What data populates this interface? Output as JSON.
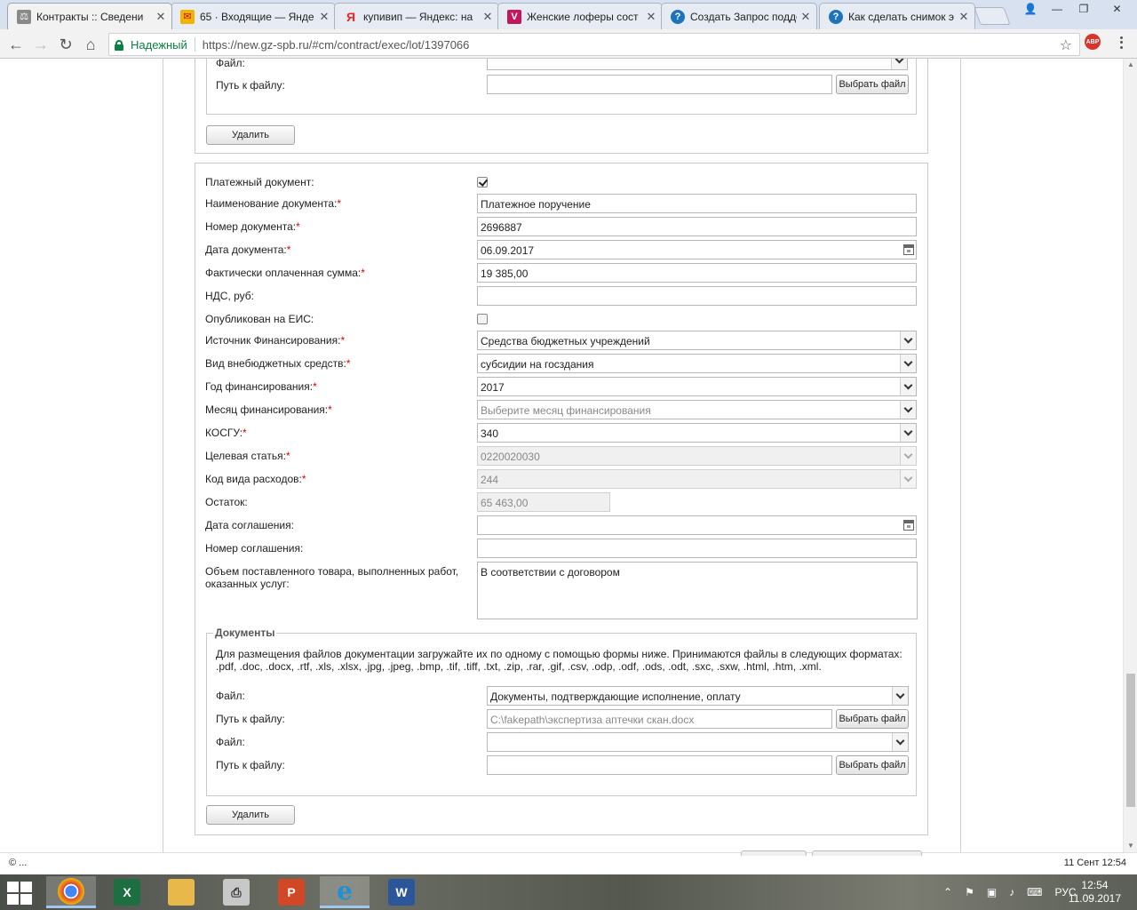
{
  "browser": {
    "tabs": [
      {
        "title": "Контракты :: Сведени",
        "icon": "gavel-icon",
        "color": "#7a7a7a",
        "glyph": "⚖"
      },
      {
        "title": "65 · Входящие — Янде",
        "icon": "mail-icon",
        "color": "#f0b400",
        "glyph": "✉"
      },
      {
        "title": "купивип — Яндекс: на",
        "icon": "yandex-icon",
        "color": "#ffffff",
        "glyph": "Я"
      },
      {
        "title": "Женские лоферы сост",
        "icon": "vip-icon",
        "color": "#c2185b",
        "glyph": "V"
      },
      {
        "title": "Создать Запрос подде",
        "icon": "help-icon",
        "color": "#1e73be",
        "glyph": "?"
      },
      {
        "title": "Как сделать снимок э",
        "icon": "help-icon",
        "color": "#1e73be",
        "glyph": "?"
      }
    ],
    "secure_label": "Надежный",
    "url": "https://new.gz-spb.ru/#cm/contract/exec/lot/1397066",
    "abp_label": "ABP",
    "win_user_icon": "user-icon"
  },
  "top_fragment": {
    "file_label": "Файл:",
    "path_label": "Путь к файлу:",
    "choose_button": "Выбрать файл",
    "delete_button": "Удалить"
  },
  "form": {
    "fields": {
      "payment_doc": {
        "label": "Платежный документ:",
        "checked": true
      },
      "doc_name": {
        "label": "Наименование документа:",
        "required": "*",
        "value": "Платежное поручение"
      },
      "doc_number": {
        "label": "Номер документа:",
        "required": "*",
        "value": "2696887"
      },
      "doc_date": {
        "label": "Дата документа:",
        "required": "*",
        "value": "06.09.2017"
      },
      "paid_sum": {
        "label": "Фактически оплаченная сумма:",
        "required": "*",
        "value": "19 385,00"
      },
      "vat": {
        "label": "НДС, руб:",
        "value": ""
      },
      "published": {
        "label": "Опубликован на ЕИС:",
        "checked": false
      },
      "funding_source": {
        "label": "Источник Финансирования:",
        "required": "*",
        "value": "Средства бюджетных учреждений"
      },
      "extrabudget": {
        "label": "Вид внебюджетных средств:",
        "required": "*",
        "value": "субсидии на госздания"
      },
      "funding_year": {
        "label": "Год финансирования:",
        "required": "*",
        "value": "2017"
      },
      "funding_month": {
        "label": "Месяц финансирования:",
        "required": "*",
        "value": "Выберите месяц финансирования"
      },
      "kosgu": {
        "label": "КОСГУ:",
        "required": "*",
        "value": "340"
      },
      "target_article": {
        "label": "Целевая статья:",
        "required": "*",
        "value": "0220020030"
      },
      "expense_code": {
        "label": "Код вида расходов:",
        "required": "*",
        "value": "244"
      },
      "remainder": {
        "label": "Остаток:",
        "value": "65 463,00"
      },
      "agreement_date": {
        "label": "Дата соглашения:",
        "value": ""
      },
      "agreement_number": {
        "label": "Номер соглашения:",
        "value": ""
      },
      "volume": {
        "label_line1": "Объем поставленного товара, выполненных работ,",
        "label_line2": "оказанных услуг:",
        "value": "В соответствии с договором"
      }
    },
    "documents": {
      "legend": "Документы",
      "info_line1": "Для размещения файлов документации загружайте их по одному с помощью формы ниже. Принимаются файлы в следующих форматах:",
      "info_line2": ".pdf, .doc, .docx, .rtf, .xls, .xlsx, .jpg, .jpeg, .bmp, .tif, .tiff, .txt, .zip, .rar, .gif, .csv, .odp, .odf, .ods, .odt, .sxc, .sxw, .html, .htm, .xml.",
      "file_label": "Файл:",
      "path_label": "Путь к файлу:",
      "file1_value": "Документы, подтверждающие исполнение, оплату",
      "path1_value": "C:\\fakepath\\экспертиза аптечки скан.docx",
      "file2_value": "",
      "path2_value": "",
      "choose_button": "Выбрать файл",
      "delete_button": "Удалить"
    }
  },
  "statusbar": {
    "left": "© ...",
    "right": "11 Сент 12:54"
  },
  "taskbar": {
    "apps": [
      {
        "name": "chrome",
        "icon": "chrome-icon",
        "color": "#db4437",
        "glyph": "◉",
        "active": true
      },
      {
        "name": "excel",
        "icon": "excel-icon",
        "color": "#1d6f42",
        "glyph": "X",
        "active": false
      },
      {
        "name": "explorer",
        "icon": "folder-icon",
        "color": "#e8b84a",
        "glyph": "▭",
        "active": false
      },
      {
        "name": "printer",
        "icon": "printer-icon",
        "color": "#9a9a9a",
        "glyph": "⎙",
        "active": false
      },
      {
        "name": "powerpoint",
        "icon": "powerpoint-icon",
        "color": "#d24726",
        "glyph": "P",
        "active": false
      },
      {
        "name": "ie",
        "icon": "internet-explorer-icon",
        "color": "#1e90d6",
        "glyph": "e",
        "active": true
      },
      {
        "name": "word",
        "icon": "word-icon",
        "color": "#2b579a",
        "glyph": "W",
        "active": false
      }
    ],
    "lang": "РУС",
    "time": "12:54",
    "date": "11.09.2017"
  }
}
